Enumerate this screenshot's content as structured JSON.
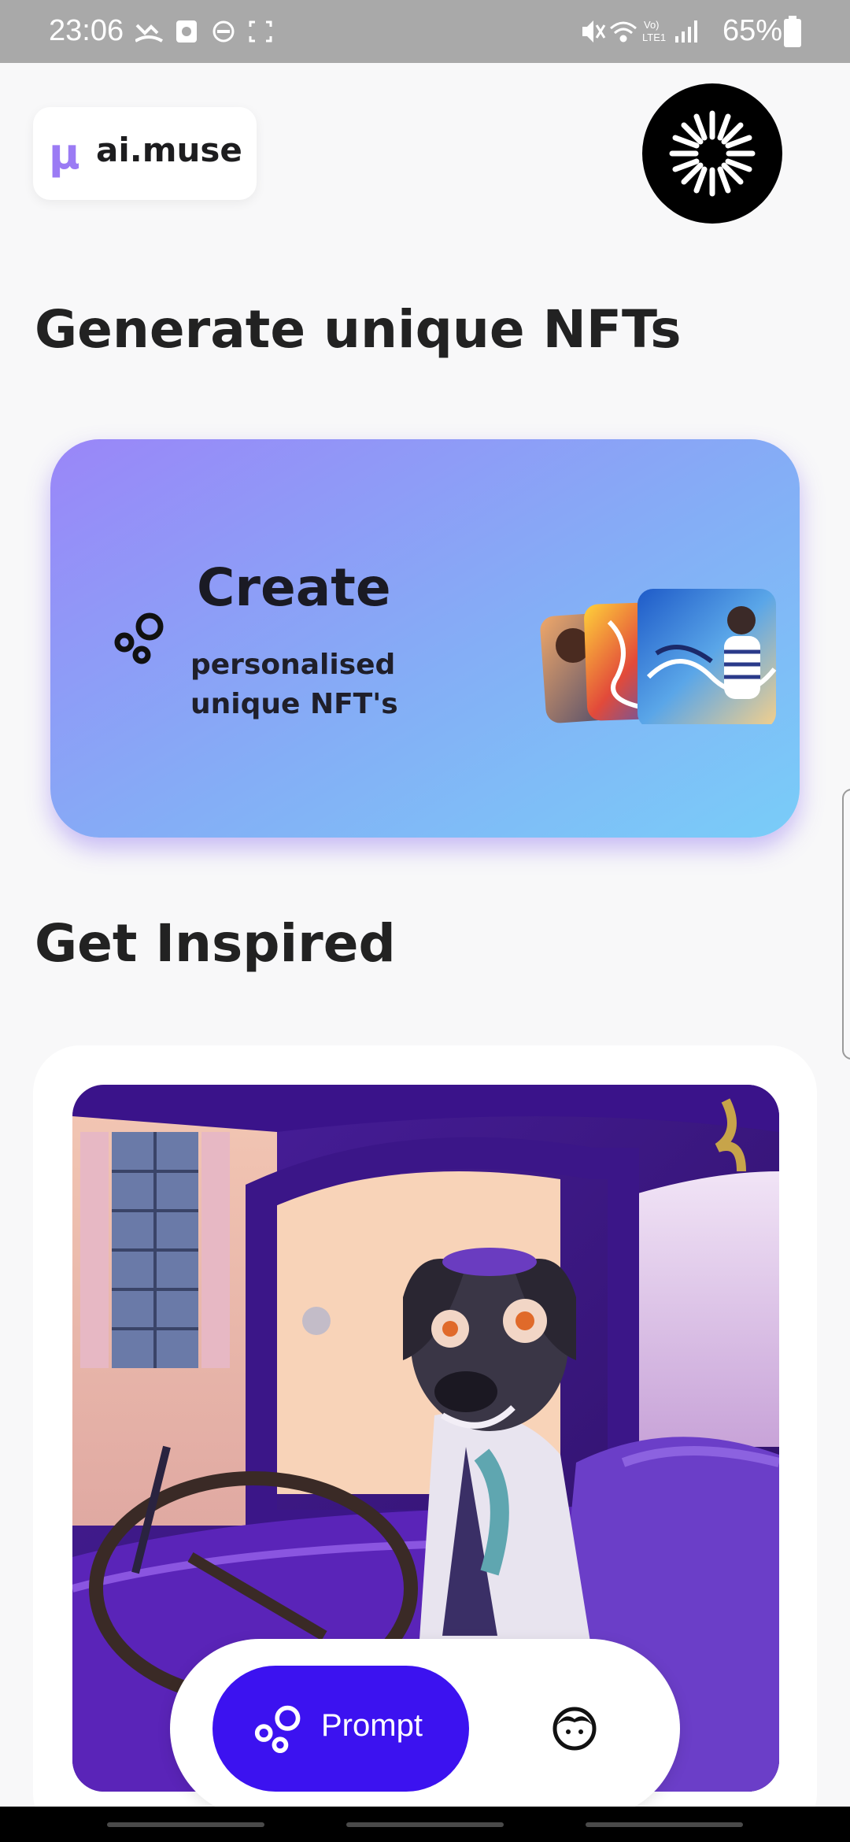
{
  "status_bar": {
    "time": "23:06",
    "battery_text": "65%",
    "icons_left": [
      "missed-call-icon",
      "screenshot-icon",
      "do-not-disturb-icon",
      "screen-capture-icon"
    ],
    "icons_right": [
      "mute-icon",
      "wifi-icon",
      "volte-icon",
      "signal-icon",
      "battery-icon"
    ]
  },
  "header": {
    "logo_mark": "μ",
    "logo_text": "ai.muse",
    "avatar_icon": "radial-burst-avatar-icon"
  },
  "main": {
    "heading": "Generate unique NFTs",
    "create_card": {
      "title": "Create",
      "subtitle": "personalised unique NFT's",
      "icon": "bubbles-icon"
    },
    "inspired_heading": "Get Inspired"
  },
  "toggle": {
    "prompt_label": "Prompt",
    "prompt_icon": "bubbles-icon",
    "face_icon": "face-icon",
    "active_color": "#3c12f0"
  },
  "colors": {
    "accent": "#3c12f0",
    "card_gradient_start": "#9a86f8",
    "card_gradient_end": "#79cdf8",
    "logo_mu": "#9b7bf4"
  }
}
